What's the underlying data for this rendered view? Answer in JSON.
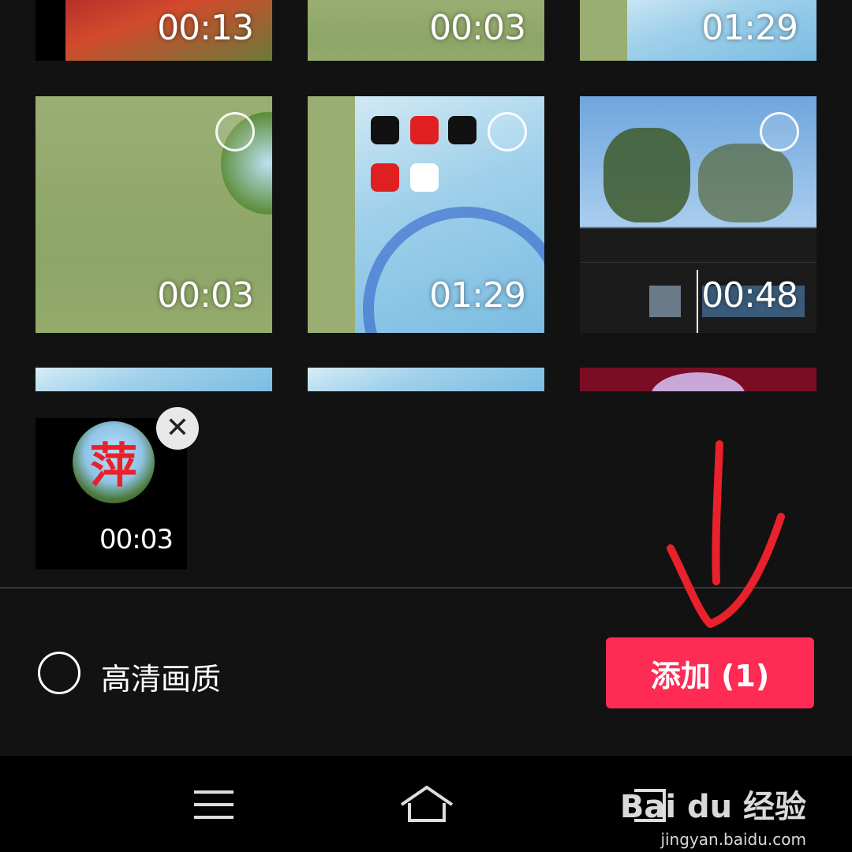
{
  "grid": {
    "row1": [
      {
        "duration": "00:13"
      },
      {
        "duration": "00:03"
      },
      {
        "duration": "01:29"
      }
    ],
    "row2": [
      {
        "duration": "00:03"
      },
      {
        "duration": "01:29"
      },
      {
        "duration": "00:48"
      }
    ]
  },
  "selected": {
    "duration": "00:03",
    "glyph": "萍",
    "remove_icon": "close-icon"
  },
  "footer": {
    "hd_label": "高清画质",
    "add_button": "添加 (1)"
  },
  "navbar": {
    "icons": [
      "menu-icon",
      "home-icon",
      "back-icon"
    ]
  },
  "watermark": {
    "logo": "Bai du 经验",
    "url": "jingyan.baidu.com"
  },
  "colors": {
    "accent": "#fe2c55",
    "background": "#121212",
    "annotation": "#e8212b"
  }
}
